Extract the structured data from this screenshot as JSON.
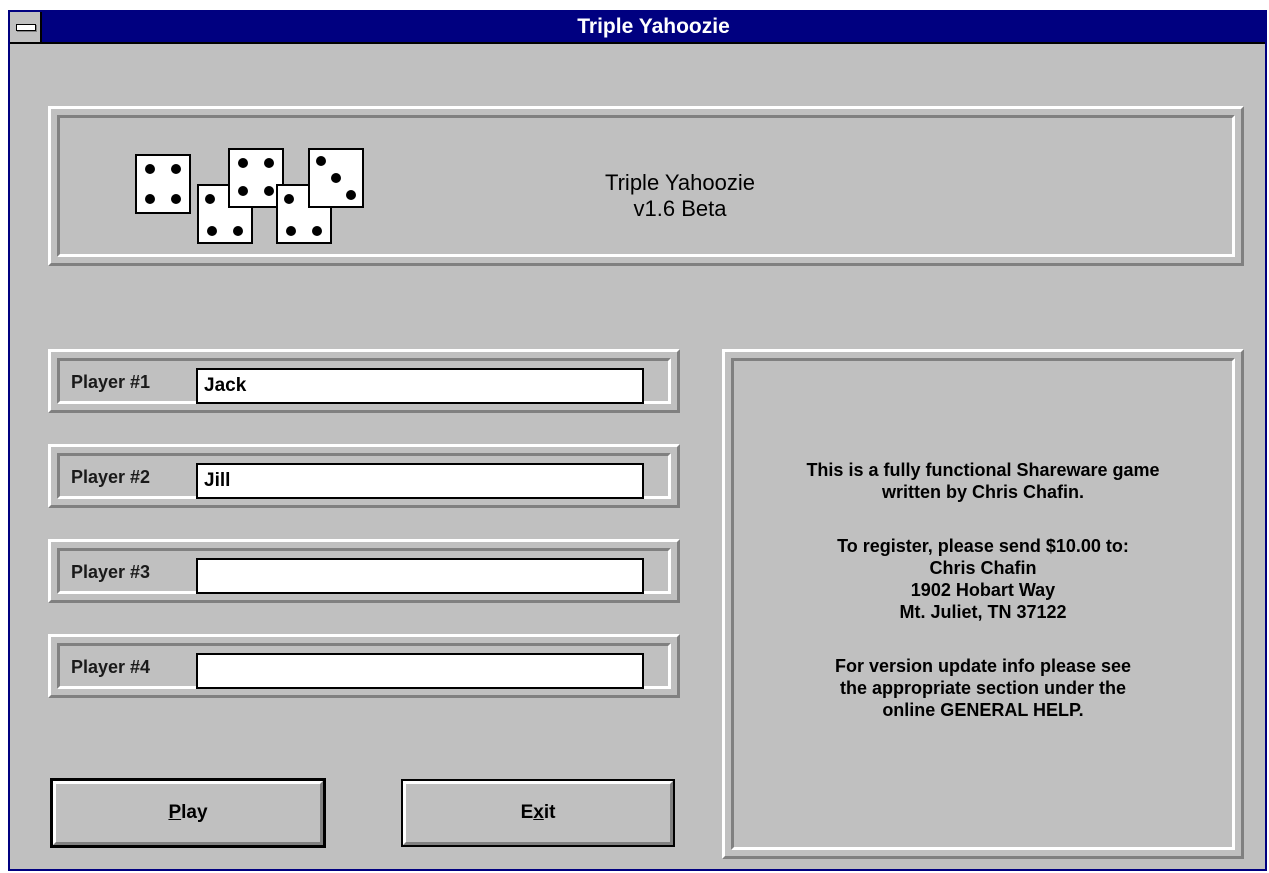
{
  "window": {
    "title": "Triple Yahoozie"
  },
  "banner": {
    "line1": "Triple Yahoozie",
    "line2": "v1.6 Beta",
    "icon": "dice-icon"
  },
  "players": [
    {
      "label": "Player #1",
      "value": "Jack"
    },
    {
      "label": "Player #2",
      "value": "Jill"
    },
    {
      "label": "Player #3",
      "value": ""
    },
    {
      "label": "Player #4",
      "value": ""
    }
  ],
  "info": {
    "line1": "This is a fully functional Shareware game",
    "line2": "written by Chris Chafin.",
    "line3": "To register, please send $10.00 to:",
    "line4": "Chris Chafin",
    "line5": "1902 Hobart Way",
    "line6": "Mt. Juliet, TN  37122",
    "line7": "For version update info please see",
    "line8": "the appropriate section under the",
    "line9": "online GENERAL HELP."
  },
  "buttons": {
    "play": {
      "mnemonic": "P",
      "rest": "lay"
    },
    "exit": {
      "pre": "E",
      "mnemonic": "x",
      "rest": "it"
    }
  },
  "colors": {
    "titlebar": "#000080",
    "face": "#c0c0c0"
  }
}
